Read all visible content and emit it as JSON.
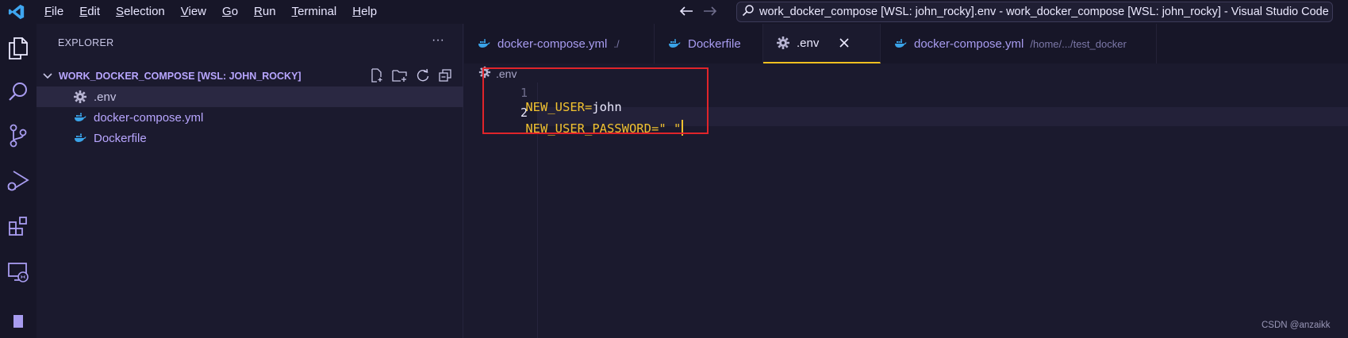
{
  "titlebar": {
    "menu": [
      {
        "label": "File",
        "u": "F",
        "rest": "ile"
      },
      {
        "label": "Edit",
        "u": "E",
        "rest": "dit"
      },
      {
        "label": "Selection",
        "u": "S",
        "rest": "election"
      },
      {
        "label": "View",
        "u": "V",
        "rest": "iew"
      },
      {
        "label": "Go",
        "u": "G",
        "rest": "o"
      },
      {
        "label": "Run",
        "u": "R",
        "rest": "un"
      },
      {
        "label": "Terminal",
        "u": "T",
        "rest": "erminal"
      },
      {
        "label": "Help",
        "u": "H",
        "rest": "elp"
      }
    ],
    "window_title": "work_docker_compose [WSL: john_rocky].env - work_docker_compose [WSL: john_rocky] - Visual Studio Code"
  },
  "sidebar": {
    "header": "EXPLORER",
    "section_title": "WORK_DOCKER_COMPOSE [WSL: JOHN_ROCKY]",
    "files": [
      {
        "name": ".env",
        "icon": "gear-icon"
      },
      {
        "name": "docker-compose.yml",
        "icon": "docker-icon"
      },
      {
        "name": "Dockerfile",
        "icon": "docker-icon"
      }
    ]
  },
  "tabs": [
    {
      "label": "docker-compose.yml",
      "desc": "./",
      "icon": "docker-icon"
    },
    {
      "label": "Dockerfile",
      "desc": "",
      "icon": "docker-icon"
    },
    {
      "label": ".env",
      "desc": "",
      "icon": "gear-icon",
      "active": true
    },
    {
      "label": "docker-compose.yml",
      "desc": "/home/.../test_docker",
      "icon": "docker-icon"
    }
  ],
  "breadcrumb": {
    "label": ".env"
  },
  "editor": {
    "lines": [
      {
        "num": "1",
        "key": "NEW_USER",
        "eq": "=",
        "value": "john",
        "string": ""
      },
      {
        "num": "2",
        "key": "NEW_USER_PASSWORD",
        "eq": "=",
        "value": "",
        "string": "\" \""
      }
    ]
  },
  "watermark": "CSDN @anzaikk",
  "colors": {
    "accent": "#f0c020",
    "highlight": "#e0242a",
    "purple": "#b8a6ff"
  }
}
